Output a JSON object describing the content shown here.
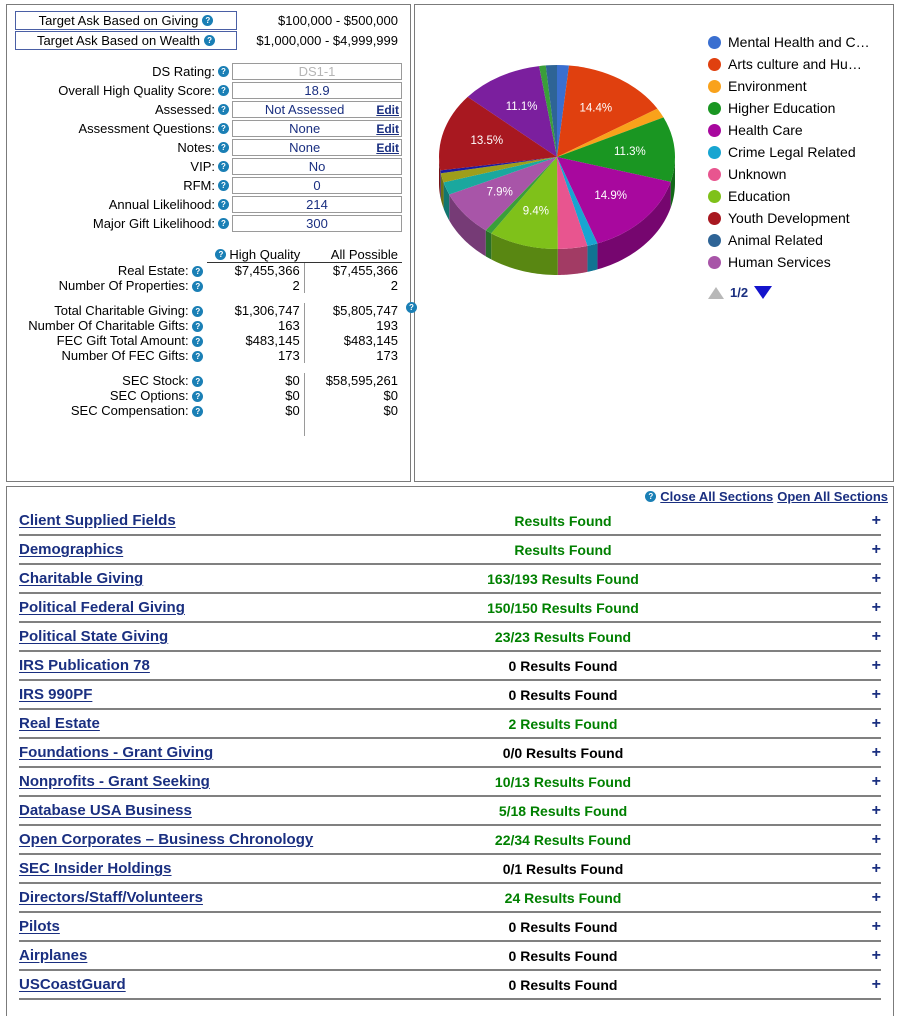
{
  "colors": {
    "accent_blue": "#1a2f80",
    "green": "#008000",
    "black": "#000000",
    "help_icon": "#1a7fb5"
  },
  "target_asks": [
    {
      "label": "Target Ask Based on Giving",
      "value": "$100,000 - $500,000"
    },
    {
      "label": "Target Ask Based on Wealth",
      "value": "$1,000,000 - $4,999,999"
    }
  ],
  "fields": [
    {
      "label": "DS Rating:",
      "value": "DS1-1",
      "muted": true,
      "edit": ""
    },
    {
      "label": "Overall High Quality Score:",
      "value": "18.9",
      "muted": false,
      "edit": ""
    },
    {
      "label": "Assessed:",
      "value": "Not Assessed",
      "muted": false,
      "edit": "Edit"
    },
    {
      "label": "Assessment Questions:",
      "value": "None",
      "muted": false,
      "edit": "Edit"
    },
    {
      "label": "Notes:",
      "value": "None",
      "muted": false,
      "edit": "Edit"
    },
    {
      "label": "VIP:",
      "value": "No",
      "muted": false,
      "edit": ""
    },
    {
      "label": "RFM:",
      "value": "0",
      "muted": false,
      "edit": ""
    },
    {
      "label": "Annual Likelihood:",
      "value": "214",
      "muted": false,
      "edit": ""
    },
    {
      "label": "Major Gift Likelihood:",
      "value": "300",
      "muted": false,
      "edit": ""
    }
  ],
  "stats": {
    "columns": [
      "High Quality",
      "All Possible"
    ],
    "groups": [
      [
        {
          "label": "Real Estate:",
          "high": "$7,455,366",
          "all": "$7,455,366"
        },
        {
          "label": "Number Of Properties:",
          "high": "2",
          "all": "2"
        }
      ],
      [
        {
          "label": "Total Charitable Giving:",
          "high": "$1,306,747",
          "all": "$5,805,747"
        },
        {
          "label": "Number Of Charitable Gifts:",
          "high": "163",
          "all": "193"
        },
        {
          "label": "FEC Gift Total Amount:",
          "high": "$483,145",
          "all": "$483,145"
        },
        {
          "label": "Number Of FEC Gifts:",
          "high": "173",
          "all": "173"
        }
      ],
      [
        {
          "label": "SEC Stock:",
          "high": "$0",
          "all": "$58,595,261"
        },
        {
          "label": "SEC Options:",
          "high": "$0",
          "all": "$0"
        },
        {
          "label": "SEC Compensation:",
          "high": "$0",
          "all": "$0"
        }
      ]
    ]
  },
  "chart_data": {
    "type": "pie",
    "title": "",
    "legend_position": "right",
    "page": "1/2",
    "labels": [
      "Mental Health and C…",
      "Arts culture and Hu…",
      "Environment",
      "Higher Education",
      "Health Care",
      "Crime Legal Related",
      "Unknown",
      "Education",
      "Youth Development",
      "Animal Related",
      "Human Services"
    ],
    "full_names": [
      "Mental Health and Crisis Intervention",
      "Arts culture and Humanities",
      "Environment",
      "Higher Education",
      "Health Care",
      "Crime Legal Related",
      "Unknown",
      "Education",
      "Youth Development",
      "Animal Related",
      "Human Services"
    ],
    "colors": [
      "#3a6fd0",
      "#e0400f",
      "#f9a21b",
      "#1a9622",
      "#a8089e",
      "#18a5d1",
      "#e8558f",
      "#7fc11a",
      "#a81820",
      "#2e6496",
      "#a855a8"
    ],
    "values": [
      1.6,
      14.4,
      1.7,
      11.3,
      14.9,
      1.4,
      4.0,
      9.4,
      13.5,
      1.5,
      7.9
    ],
    "shown_percent_labels": [
      {
        "slice": "Arts culture and Hu…",
        "text": "14.4%"
      },
      {
        "slice": "Higher Education",
        "text": "11.3%"
      },
      {
        "slice": "Health Care",
        "text": "14.9%"
      },
      {
        "slice": "Education",
        "text": "9.4%"
      },
      {
        "slice": "Human Services",
        "text": "7.9%"
      },
      {
        "slice": "Youth Development",
        "text": "13.5%"
      },
      {
        "slice": "Other Purple",
        "text": "11.1%"
      }
    ],
    "other_slices_colors": [
      "#7b1f9e",
      "#3a9e3a",
      "#1a1a9e",
      "#9e9e1a",
      "#1aa89e"
    ],
    "other_slices_values": [
      11.1,
      0.9,
      0.5,
      1.6,
      2.2
    ],
    "ylabel": "",
    "xlabel": ""
  },
  "accordion": {
    "help_icon": "help-icon",
    "close_all": "Close All Sections",
    "open_all": "Open All Sections",
    "expand_symbol": "+",
    "rows": [
      {
        "title": "Client Supplied Fields",
        "result": "Results Found",
        "color": "green"
      },
      {
        "title": "Demographics",
        "result": "Results Found",
        "color": "green"
      },
      {
        "title": "Charitable Giving",
        "result": "163/193 Results Found",
        "color": "green"
      },
      {
        "title": "Political Federal Giving",
        "result": "150/150 Results Found",
        "color": "green"
      },
      {
        "title": "Political State Giving",
        "result": "23/23 Results Found",
        "color": "green"
      },
      {
        "title": "IRS Publication 78",
        "result": "0 Results Found",
        "color": "black"
      },
      {
        "title": "IRS 990PF",
        "result": "0 Results Found",
        "color": "black"
      },
      {
        "title": "Real Estate",
        "result": "2 Results Found",
        "color": "green"
      },
      {
        "title": "Foundations - Grant Giving",
        "result": "0/0 Results Found",
        "color": "black"
      },
      {
        "title": "Nonprofits - Grant Seeking",
        "result": "10/13 Results Found",
        "color": "green"
      },
      {
        "title": "Database USA Business",
        "result": "5/18 Results Found",
        "color": "green"
      },
      {
        "title": "Open Corporates – Business Chronology",
        "result": "22/34 Results Found",
        "color": "green"
      },
      {
        "title": "SEC Insider Holdings",
        "result": "0/1 Results Found",
        "color": "black"
      },
      {
        "title": "Directors/Staff/Volunteers",
        "result": "24 Results Found",
        "color": "green"
      },
      {
        "title": "Pilots",
        "result": "0 Results Found",
        "color": "black"
      },
      {
        "title": "Airplanes",
        "result": "0 Results Found",
        "color": "black"
      },
      {
        "title": "USCoastGuard",
        "result": "0 Results Found",
        "color": "black"
      }
    ]
  }
}
